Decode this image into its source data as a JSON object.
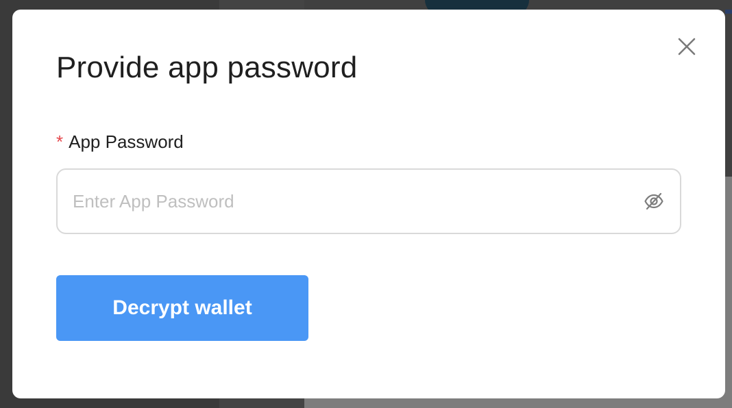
{
  "modal": {
    "title": "Provide app password",
    "close_icon": "close-icon"
  },
  "form": {
    "field_label": "App Password",
    "required_mark": "*",
    "password_placeholder": "Enter App Password",
    "password_value": "",
    "visibility_icon": "eye-slash-icon"
  },
  "actions": {
    "decrypt_label": "Decrypt wallet"
  },
  "colors": {
    "primary_button": "#4a97f5",
    "required_star": "#e5484d",
    "input_border": "#d9d9d9",
    "placeholder": "#bfbfbf"
  }
}
